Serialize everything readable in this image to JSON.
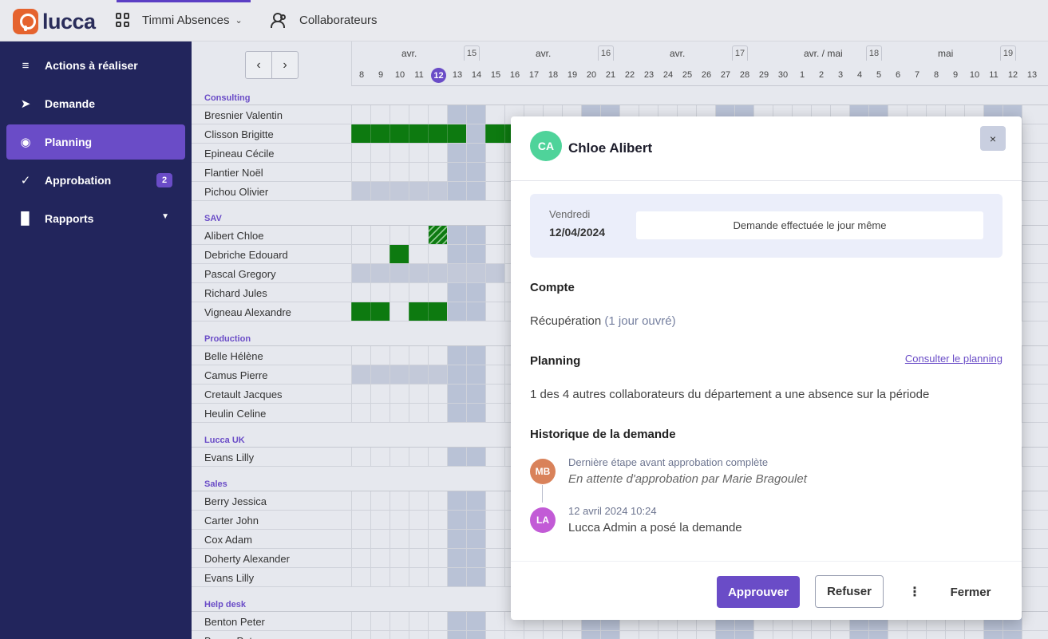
{
  "topbar": {
    "logo_text": "lucca",
    "app_name": "Timmi Absences",
    "collab_label": "Collaborateurs"
  },
  "sidebar": {
    "items": [
      {
        "label": "Actions à réaliser",
        "icon": "checklist-icon"
      },
      {
        "label": "Demande",
        "icon": "send-icon"
      },
      {
        "label": "Planning",
        "icon": "eye-icon",
        "active": true
      },
      {
        "label": "Approbation",
        "icon": "check-icon",
        "badge": "2"
      },
      {
        "label": "Rapports",
        "icon": "bar-chart-icon"
      }
    ]
  },
  "calendar": {
    "months": [
      "avr.",
      "avr.",
      "avr.",
      "avr. / mai",
      "mai"
    ],
    "weeks": [
      "15",
      "16",
      "17",
      "18",
      "19"
    ],
    "days": [
      "8",
      "9",
      "10",
      "11",
      "12",
      "13",
      "14",
      "15",
      "16",
      "17",
      "18",
      "19",
      "20",
      "21",
      "22",
      "23",
      "24",
      "25",
      "26",
      "27",
      "28",
      "29",
      "30",
      "1",
      "2",
      "3",
      "4",
      "5",
      "6",
      "7",
      "8",
      "9",
      "10",
      "11",
      "12",
      "13"
    ],
    "today": "12",
    "groups": [
      {
        "name": "Consulting",
        "people": [
          "Bresnier Valentin",
          "Clisson Brigitte",
          "Epineau Cécile",
          "Flantier Noël",
          "Pichou Olivier"
        ]
      },
      {
        "name": "SAV",
        "people": [
          "Alibert Chloe",
          "Debriche Edouard",
          "Pascal Gregory",
          "Richard Jules",
          "Vigneau Alexandre"
        ]
      },
      {
        "name": "Production",
        "people": [
          "Belle Hélène",
          "Camus Pierre",
          "Cretault Jacques",
          "Heulin Celine"
        ]
      },
      {
        "name": "Lucca UK",
        "people": [
          "Evans Lilly"
        ]
      },
      {
        "name": "Sales",
        "people": [
          "Berry Jessica",
          "Carter John",
          "Cox Adam",
          "Doherty Alexander",
          "Evans Lilly"
        ]
      },
      {
        "name": "Help desk",
        "people": [
          "Benton Peter",
          "Brown Peter"
        ]
      }
    ]
  },
  "modal": {
    "avatar_initials": "CA",
    "title": "Chloe Alibert",
    "close_icon": "×",
    "day_name": "Vendredi",
    "date": "12/04/2024",
    "notice": "Demande effectuée le jour même",
    "compte_title": "Compte",
    "compte_value": "Récupération",
    "compte_detail": "(1 jour ouvré)",
    "planning_title": "Planning",
    "planning_link": "Consulter le planning",
    "planning_text": "1 des 4 autres collaborateurs du département a une absence sur la période",
    "history_title": "Historique de la demande",
    "history": [
      {
        "initials": "MB",
        "meta": "Dernière étape avant approbation complète",
        "text": "En attente d'approbation par Marie Bragoulet",
        "color": "#d9825a"
      },
      {
        "initials": "LA",
        "meta": "12 avril 2024 10:24",
        "text": "Lucca Admin a posé la demande",
        "color": "#c25bd6"
      }
    ],
    "approve_label": "Approuver",
    "refuse_label": "Refuser",
    "more_label": "⋮",
    "close_label": "Fermer"
  },
  "colors": {
    "sidebar_bg": "#22255c",
    "accent": "#6a4cc7",
    "absence": "#0d7a10",
    "avatar_ca": "#4fd39a"
  }
}
